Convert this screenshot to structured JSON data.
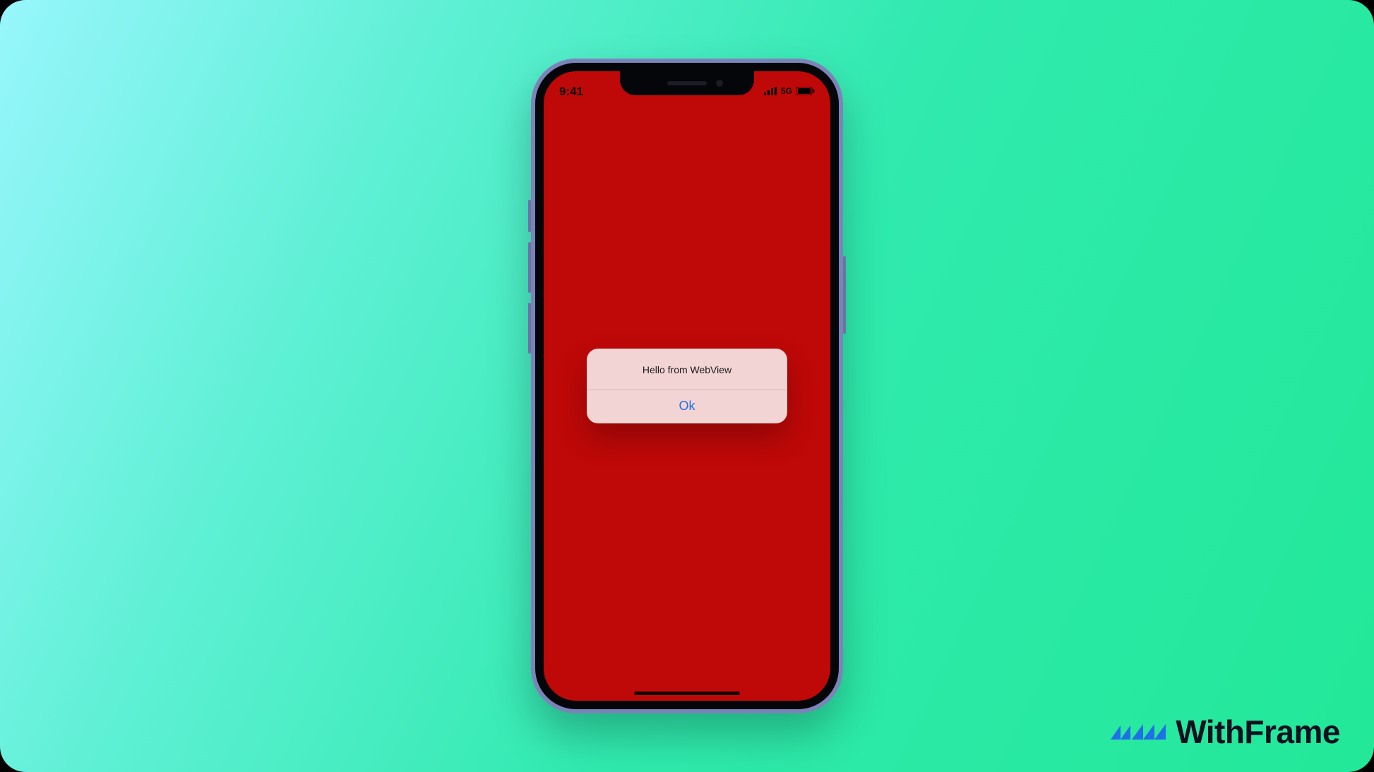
{
  "status_bar": {
    "time": "9:41",
    "network_type": "5G"
  },
  "alert": {
    "message": "Hello from WebView",
    "ok_label": "Ok"
  },
  "watermark": {
    "brand": "WithFrame"
  },
  "colors": {
    "screen_bg": "#bf0808",
    "ios_blue": "#1f6fe6"
  }
}
